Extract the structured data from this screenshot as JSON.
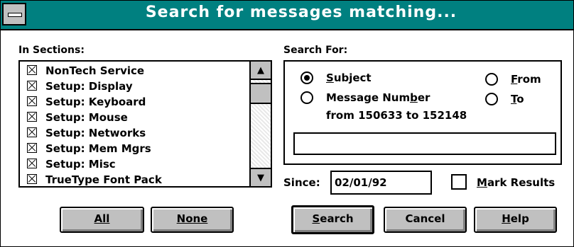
{
  "window": {
    "title": "Search for messages matching..."
  },
  "sections": {
    "label": "In Sections:",
    "items": [
      {
        "label": "NonTech Service",
        "checked": true
      },
      {
        "label": "Setup: Display",
        "checked": true
      },
      {
        "label": "Setup: Keyboard",
        "checked": true
      },
      {
        "label": "Setup: Mouse",
        "checked": true
      },
      {
        "label": "Setup: Networks",
        "checked": true
      },
      {
        "label": "Setup: Mem Mgrs",
        "checked": true
      },
      {
        "label": "Setup: Misc",
        "checked": true
      },
      {
        "label": "TrueType Font Pack",
        "checked": true
      }
    ],
    "all_label": "All",
    "none_label": "None"
  },
  "search_for": {
    "label": "Search For:",
    "subject": {
      "first": "S",
      "rest": "ubject",
      "selected": true
    },
    "from": {
      "first": "F",
      "rest": "rom",
      "selected": false
    },
    "message_number": {
      "pre": "Message Num",
      "ul": "b",
      "post": "er",
      "selected": false
    },
    "to": {
      "first": "T",
      "rest": "o",
      "selected": false
    },
    "range_text": "from 150633 to 152148",
    "query_value": ""
  },
  "since": {
    "label": "Since:",
    "value": "02/01/92"
  },
  "mark_results": {
    "first": "M",
    "rest": "ark Results",
    "checked": false
  },
  "buttons": {
    "search": {
      "first": "S",
      "rest": "earch"
    },
    "cancel": "Cancel",
    "help": {
      "first": "H",
      "rest": "elp"
    }
  }
}
